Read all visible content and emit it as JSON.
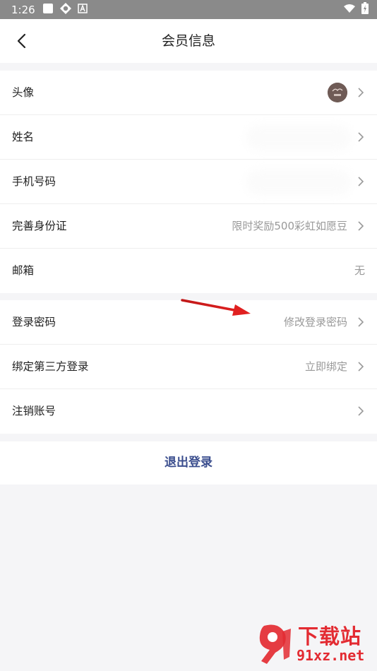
{
  "status_bar": {
    "time": "1:26",
    "icons": [
      "square-icon",
      "sync-icon",
      "a-icon"
    ],
    "right_icons": [
      "wifi-icon",
      "battery-icon"
    ]
  },
  "header": {
    "title": "会员信息",
    "back_icon": "back-chevron-icon"
  },
  "profile_group": [
    {
      "label": "头像",
      "value": "",
      "type": "avatar"
    },
    {
      "label": "姓名",
      "value": "",
      "type": "blurred"
    },
    {
      "label": "手机号码",
      "value": "",
      "type": "blurred"
    },
    {
      "label": "完善身份证",
      "value": "限时奖励500彩虹如愿豆",
      "type": "text"
    },
    {
      "label": "邮箱",
      "value": "无",
      "type": "text-noarrow"
    }
  ],
  "account_group": [
    {
      "label": "登录密码",
      "value": "修改登录密码"
    },
    {
      "label": "绑定第三方登录",
      "value": "立即绑定"
    },
    {
      "label": "注销账号",
      "value": ""
    }
  ],
  "logout_label": "退出登录",
  "watermark": {
    "top_text": "下载站",
    "bottom_text": "91xz.net"
  },
  "colors": {
    "accent_text": "#3b4e8e",
    "secondary_text": "#999999",
    "annotation_arrow": "#e02020",
    "watermark": "#e32b32",
    "status_bar": "#8a8a8a"
  }
}
